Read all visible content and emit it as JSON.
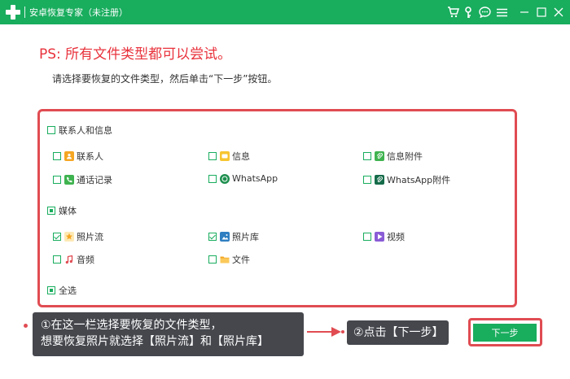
{
  "window": {
    "title": "安卓恢复专家（未注册）",
    "brand_color": "#19ad5e",
    "toolbar_icons": [
      "cart-icon",
      "key-icon",
      "chat-icon",
      "menu-icon",
      "minimize-icon",
      "maximize-icon",
      "close-icon"
    ]
  },
  "header": {
    "ps_text": "PS: 所有文件类型都可以尝试。",
    "instruction": "请选择要恢复的文件类型，然后单击“下一步”按钮。"
  },
  "groups": {
    "contacts": {
      "label": "联系人和信息",
      "state": "unchecked",
      "items": [
        {
          "label": "联系人",
          "checked": false,
          "icon": "contacts-icon",
          "color": "#f5a623"
        },
        {
          "label": "信息",
          "checked": false,
          "icon": "message-icon",
          "color": "#f7c531"
        },
        {
          "label": "信息附件",
          "checked": false,
          "icon": "attachment-icon",
          "color": "#3fb34f"
        },
        {
          "label": "通话记录",
          "checked": false,
          "icon": "call-log-icon",
          "color": "#3fb34f"
        },
        {
          "label": "WhatsApp",
          "checked": false,
          "icon": "whatsapp-icon",
          "color": "#1e8f4e"
        },
        {
          "label": "WhatsApp附件",
          "checked": false,
          "icon": "whatsapp-attachment-icon",
          "color": "#156b4a"
        }
      ]
    },
    "media": {
      "label": "媒体",
      "state": "partial",
      "items": [
        {
          "label": "照片流",
          "checked": true,
          "icon": "photo-stream-icon",
          "color": "#f5a623"
        },
        {
          "label": "照片库",
          "checked": true,
          "icon": "photo-library-icon",
          "color": "#2f7fc1"
        },
        {
          "label": "视频",
          "checked": false,
          "icon": "video-icon",
          "color": "#8a5cd6"
        },
        {
          "label": "音频",
          "checked": false,
          "icon": "audio-icon",
          "color": "#e04c52"
        },
        {
          "label": "文件",
          "checked": false,
          "icon": "folder-icon",
          "color": "#f5a623"
        }
      ]
    },
    "select_all": {
      "label": "全选",
      "state": "partial"
    }
  },
  "callouts": {
    "step1_line1": "①在这一栏选择要恢复的文件类型，",
    "step1_line2": "想要恢复照片就选择【照片流】和【照片库】",
    "step2": "②点击【下一步】",
    "accent": "#e04c52"
  },
  "buttons": {
    "next_label": "下一步"
  }
}
